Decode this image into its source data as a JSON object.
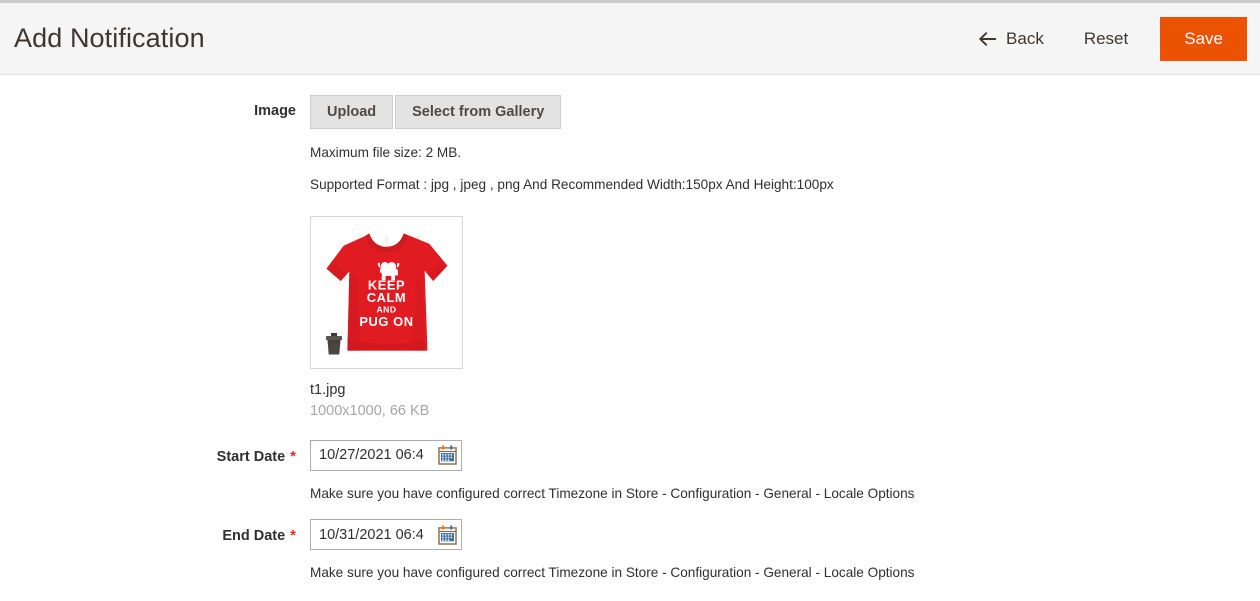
{
  "header": {
    "title": "Add Notification",
    "back_label": "Back",
    "back_icon": "arrow-left-icon",
    "reset_label": "Reset",
    "save_label": "Save",
    "save_color": "#eb5202",
    "background": "#f5f5f5"
  },
  "form": {
    "image": {
      "label": "Image",
      "upload_label": "Upload",
      "gallery_label": "Select from Gallery",
      "note_size": "Maximum file size: 2 MB.",
      "note_format": "Supported Format : jpg , jpeg , png And Recommended Width:150px And Height:100px",
      "preview": {
        "alt": "Red t-shirt with KEEP CALM AND PUG ON print",
        "shirt_color": "#e01b22",
        "print_line_1": "KEEP",
        "print_line_2": "CALM",
        "print_line_3": "AND",
        "print_line_4": "PUG ON",
        "delete_icon": "trash-icon"
      },
      "file_name": "t1.jpg",
      "file_meta": "1000x1000, 66 KB"
    },
    "start_date": {
      "label": "Start Date",
      "required": "*",
      "value": "10/27/2021 06:4",
      "calendar_icon": "calendar-icon",
      "hint": "Make sure you have configured correct Timezone in Store - Configuration - General - Locale Options"
    },
    "end_date": {
      "label": "End Date",
      "required": "*",
      "value": "10/31/2021 06:4",
      "calendar_icon": "calendar-icon",
      "hint": "Make sure you have configured correct Timezone in Store - Configuration - General - Locale Options"
    }
  }
}
